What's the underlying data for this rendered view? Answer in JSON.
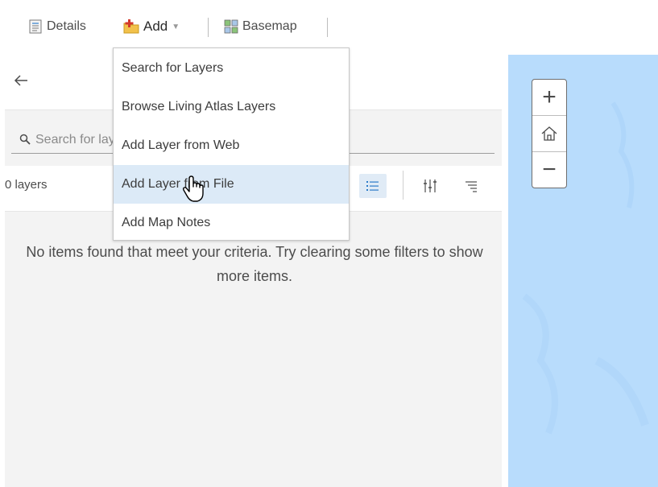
{
  "toolbar": {
    "details_label": "Details",
    "add_label": "Add",
    "basemap_label": "Basemap"
  },
  "panel": {
    "search_placeholder": "Search for layers",
    "layer_count": "0 layers",
    "empty_message": "No items found that meet your criteria. Try clearing some filters to show more items."
  },
  "add_menu": {
    "items": [
      {
        "label": "Search for Layers"
      },
      {
        "label": "Browse Living Atlas Layers"
      },
      {
        "label": "Add Layer from Web"
      },
      {
        "label": "Add Layer from File"
      },
      {
        "label": "Add Map Notes"
      }
    ],
    "hovered": "Add Layer from File"
  },
  "map": {
    "zoom_in_label": "+",
    "zoom_out_label": "−"
  },
  "colors": {
    "map_water": "#b8dcfc",
    "menu_hover": "#dceaf7",
    "panel_bg": "#f3f3f3"
  },
  "icons": [
    "details-icon",
    "add-icon",
    "basemap-icon",
    "back-arrow-icon",
    "search-icon",
    "list-view-icon",
    "filter-icon",
    "sort-icon",
    "home-icon",
    "hand-cursor-icon"
  ]
}
